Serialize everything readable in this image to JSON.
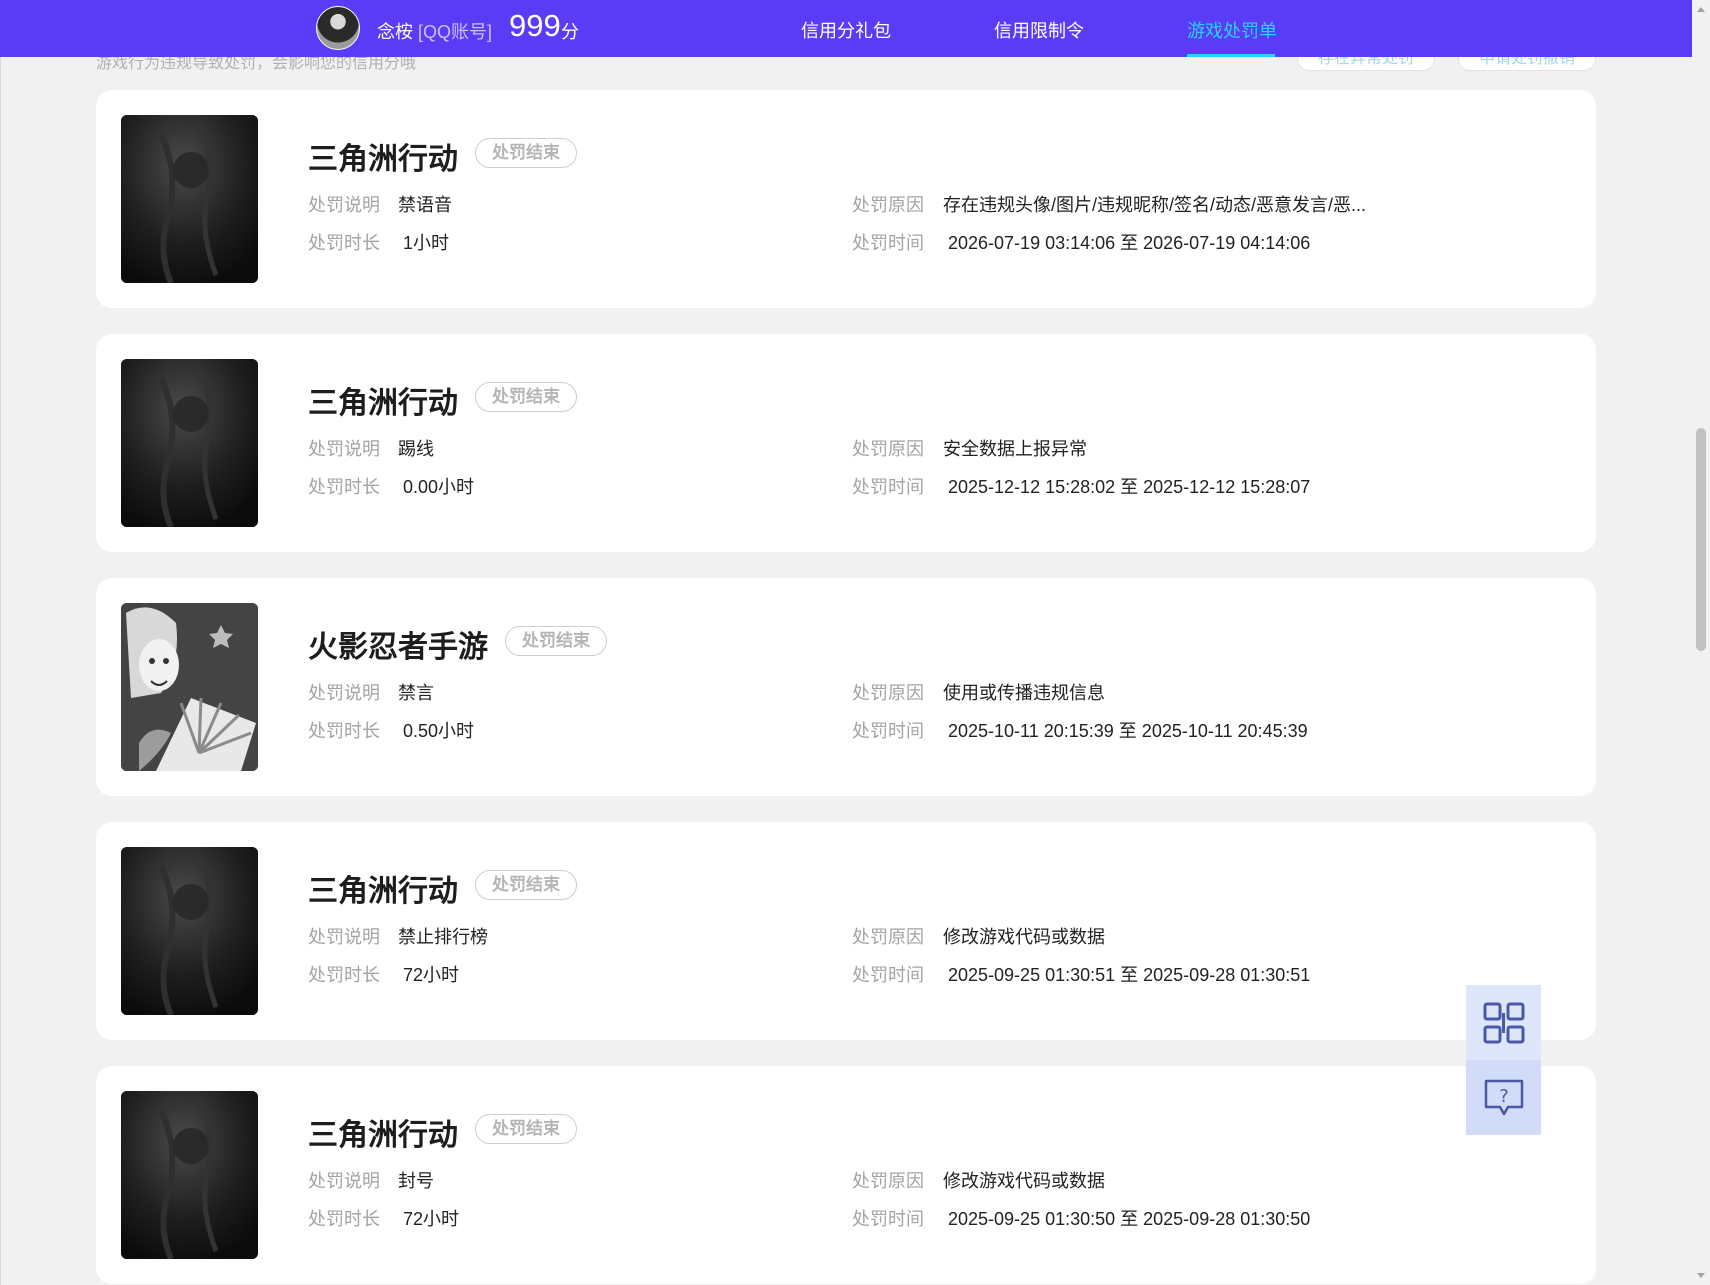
{
  "header": {
    "username": "念桉",
    "account_type": "[QQ账号]",
    "score_value": "999",
    "score_unit": "分",
    "tabs": [
      {
        "label": "信用分礼包",
        "active": false
      },
      {
        "label": "信用限制令",
        "active": false
      },
      {
        "label": "游戏处罚单",
        "active": true
      }
    ],
    "brand_color": "#5b3cf6",
    "active_color": "#27d3ff"
  },
  "partial_top": {
    "description": "游戏行为违规导致处罚，会影响您的信用分哦",
    "button_left": "存在异常处罚",
    "button_right": "申请处罚撤销"
  },
  "labels": {
    "explanation": "处罚说明",
    "duration": "处罚时长",
    "reason": "处罚原因",
    "time": "处罚时间"
  },
  "penalties": [
    {
      "game": "三角洲行动",
      "status": "处罚结束",
      "explanation": "禁语音",
      "duration": "1小时",
      "reason": "存在违规头像/图片/违规昵称/签名/动态/恶意发言/恶...",
      "time": "2026-07-19 03:14:06 至 2026-07-19 04:14:06",
      "icon": "delta-force-game-icon"
    },
    {
      "game": "三角洲行动",
      "status": "处罚结束",
      "explanation": "踢线",
      "duration": "0.00小时",
      "reason": "安全数据上报异常",
      "time": "2025-12-12 15:28:02 至 2025-12-12 15:28:07",
      "icon": "delta-force-game-icon"
    },
    {
      "game": "火影忍者手游",
      "status": "处罚结束",
      "explanation": "禁言",
      "duration": "0.50小时",
      "reason": "使用或传播违规信息",
      "time": "2025-10-11 20:15:39 至 2025-10-11 20:45:39",
      "icon": "naruto-game-icon"
    },
    {
      "game": "三角洲行动",
      "status": "处罚结束",
      "explanation": "禁止排行榜",
      "duration": "72小时",
      "reason": "修改游戏代码或数据",
      "time": "2025-09-25 01:30:51 至 2025-09-28 01:30:51",
      "icon": "delta-force-game-icon"
    },
    {
      "game": "三角洲行动",
      "status": "处罚结束",
      "explanation": "封号",
      "duration": "72小时",
      "reason": "修改游戏代码或数据",
      "time": "2025-09-25 01:30:50 至 2025-09-28 01:30:50",
      "icon": "delta-force-game-icon"
    }
  ],
  "side_tools": [
    {
      "icon": "qr-code-icon"
    },
    {
      "icon": "help-feedback-icon"
    }
  ]
}
